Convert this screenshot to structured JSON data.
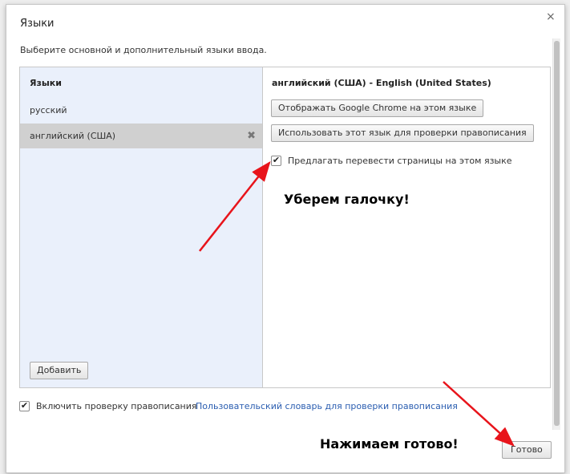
{
  "dialog": {
    "title": "Языки",
    "close_glyph": "×",
    "subtitle": "Выберите основной и дополнительный языки ввода."
  },
  "languages": {
    "heading": "Языки",
    "items": [
      {
        "label": "русский"
      },
      {
        "label": "английский (США)",
        "selected": true
      }
    ],
    "remove_glyph": "✖",
    "add_button": "Добавить"
  },
  "details": {
    "heading": "английский (США) - English (United States)",
    "display_button": "Отображать Google Chrome на этом языке",
    "spellcheck_button": "Использовать этот язык для проверки правописания",
    "translate_checkbox": {
      "label": "Предлагать перевести страницы на этом языке",
      "checked": true,
      "glyph": "✔"
    }
  },
  "footer": {
    "spellcheck_checkbox": {
      "label": "Включить проверку правописания",
      "checked": true,
      "glyph": "✔"
    },
    "custom_dictionary_link": "Пользовательский словарь для проверки правописания",
    "done_button": "Готово"
  },
  "annotations": {
    "uncheck_note": "Уберем галочку!",
    "done_note": "Нажимаем готово!",
    "arrow_color": "#e8141b"
  }
}
